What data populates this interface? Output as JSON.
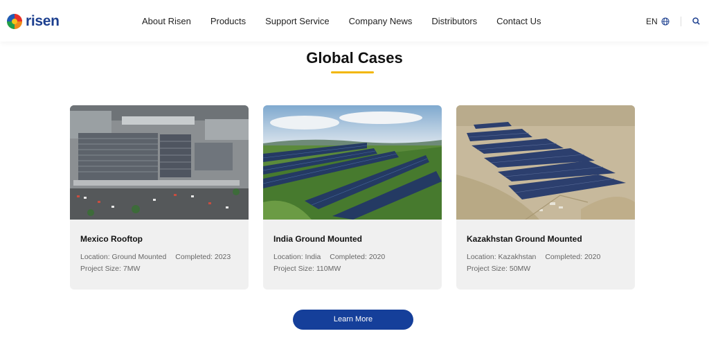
{
  "brand": {
    "name": "risen",
    "color": "#1c3f8f"
  },
  "nav": {
    "items": [
      "About Risen",
      "Products",
      "Support Service",
      "Company News",
      "Distributors",
      "Contact Us"
    ]
  },
  "lang": {
    "label": "EN",
    "icon": "globe-icon"
  },
  "search": {
    "icon": "search-icon"
  },
  "section": {
    "title": "Global Cases",
    "accent": "#f2b705"
  },
  "cases": [
    {
      "title": "Mexico Rooftop",
      "location": "Location: Ground Mounted",
      "completed": "Completed: 2023",
      "size": "Project Size: 7MW",
      "image": "aerial-rooftop-solar-factory"
    },
    {
      "title": "India Ground Mounted",
      "location": "Location: India",
      "completed": "Completed: 2020",
      "size": "Project Size: 110MW",
      "image": "ground-mounted-solar-rows-on-green-hills"
    },
    {
      "title": "Kazakhstan Ground Mounted",
      "location": "Location: Kazakhstan",
      "completed": "Completed: 2020",
      "size": "Project Size: 50MW",
      "image": "aerial-solar-farm-in-desert"
    }
  ],
  "cta": {
    "label": "Learn More",
    "color": "#153f9a"
  }
}
